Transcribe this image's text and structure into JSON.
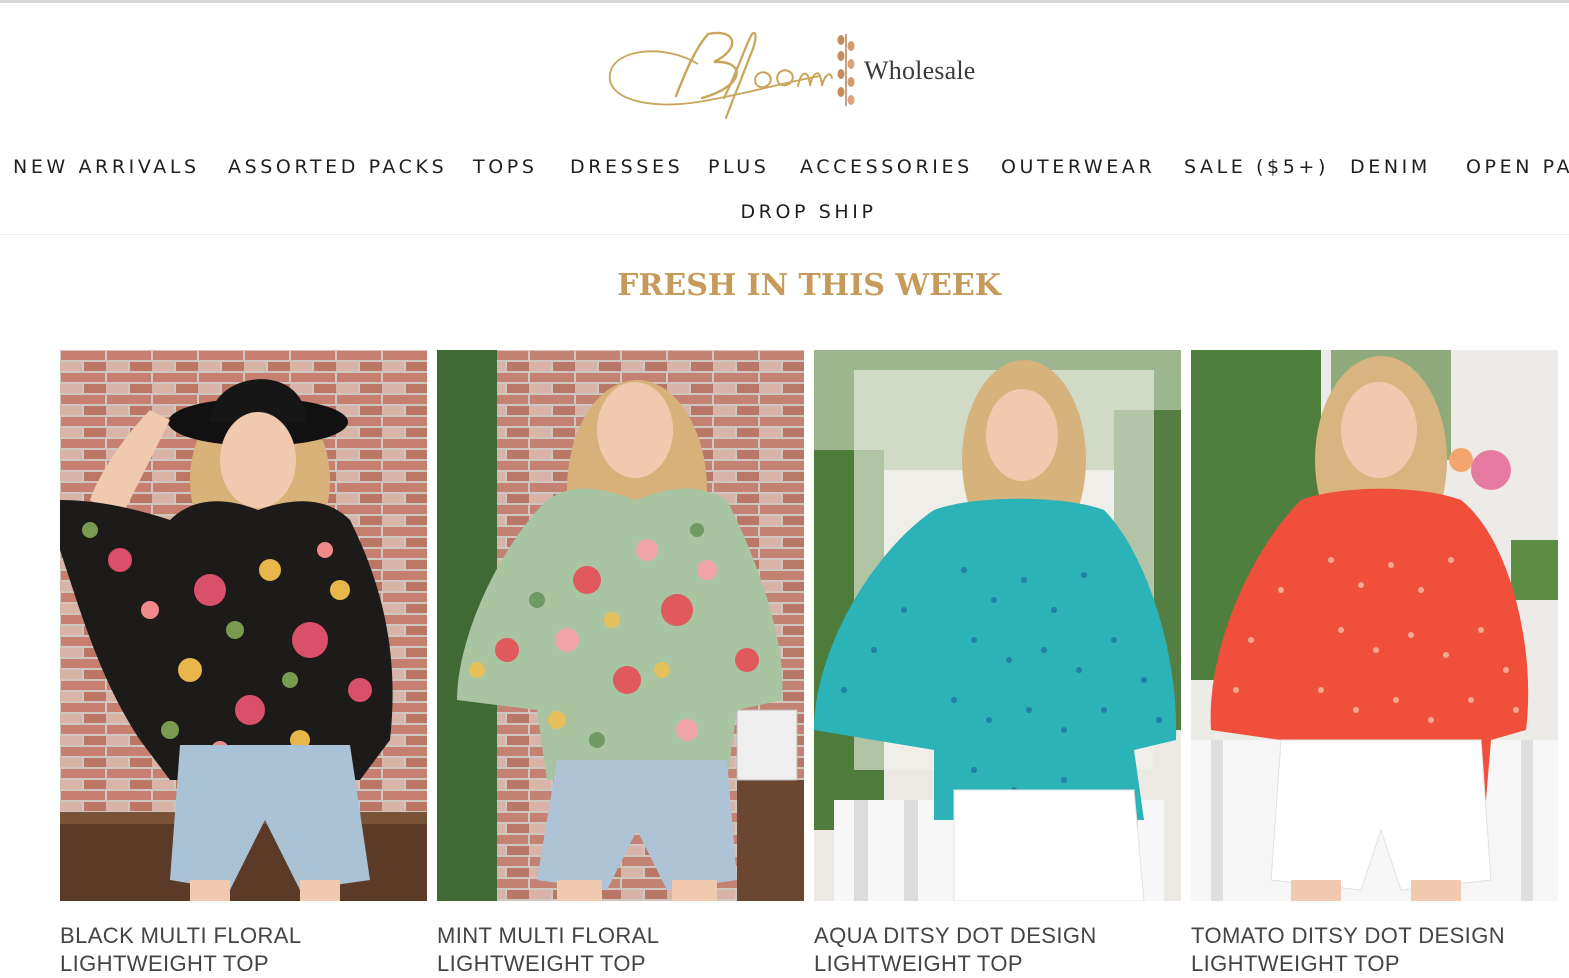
{
  "brand": {
    "script_name": "Bloom",
    "word": "Wholesale",
    "gold": "#c9a55a",
    "leaf_color": "#c98a5a"
  },
  "nav": {
    "items": [
      {
        "label": "NEW ARRIVALS"
      },
      {
        "label": "ASSORTED PACKS"
      },
      {
        "label": "TOPS"
      },
      {
        "label": "DRESSES"
      },
      {
        "label": "PLUS"
      },
      {
        "label": "ACCESSORIES"
      },
      {
        "label": "OUTERWEAR"
      },
      {
        "label": "SALE ($5+)"
      },
      {
        "label": "DENIM"
      },
      {
        "label": "OPEN PA"
      }
    ],
    "row2": {
      "label": "DROP SHIP"
    }
  },
  "section": {
    "title": "FRESH IN THIS WEEK",
    "title_color": "#c59a5b"
  },
  "products": [
    {
      "line1": "BLACK MULTI FLORAL",
      "line2": "LIGHTWEIGHT TOP",
      "top_color": "#1d1a1a",
      "print_colors": [
        "#d9506a",
        "#e8b64a",
        "#7a9b4f",
        "#f08a8a"
      ],
      "bottom": "denim-shorts",
      "background": "brick"
    },
    {
      "line1": "MINT MULTI FLORAL",
      "line2": "LIGHTWEIGHT TOP",
      "top_color": "#a8c4a0",
      "print_colors": [
        "#e0595d",
        "#f0a4a4",
        "#e6c05a",
        "#6f9a63"
      ],
      "bottom": "denim-shorts",
      "background": "brick"
    },
    {
      "line1": "AQUA DITSY DOT DESIGN",
      "line2": "LIGHTWEIGHT TOP",
      "top_color": "#2bb3b8",
      "print_colors": [
        "#1d6fa0"
      ],
      "bottom": "white-jeans",
      "background": "greenery"
    },
    {
      "line1": "TOMATO DITSY DOT DESIGN",
      "line2": "LIGHTWEIGHT TOP",
      "top_color": "#ef4f3b",
      "print_colors": [
        "#f6b7a0"
      ],
      "bottom": "white-shorts",
      "background": "greenery"
    }
  ]
}
